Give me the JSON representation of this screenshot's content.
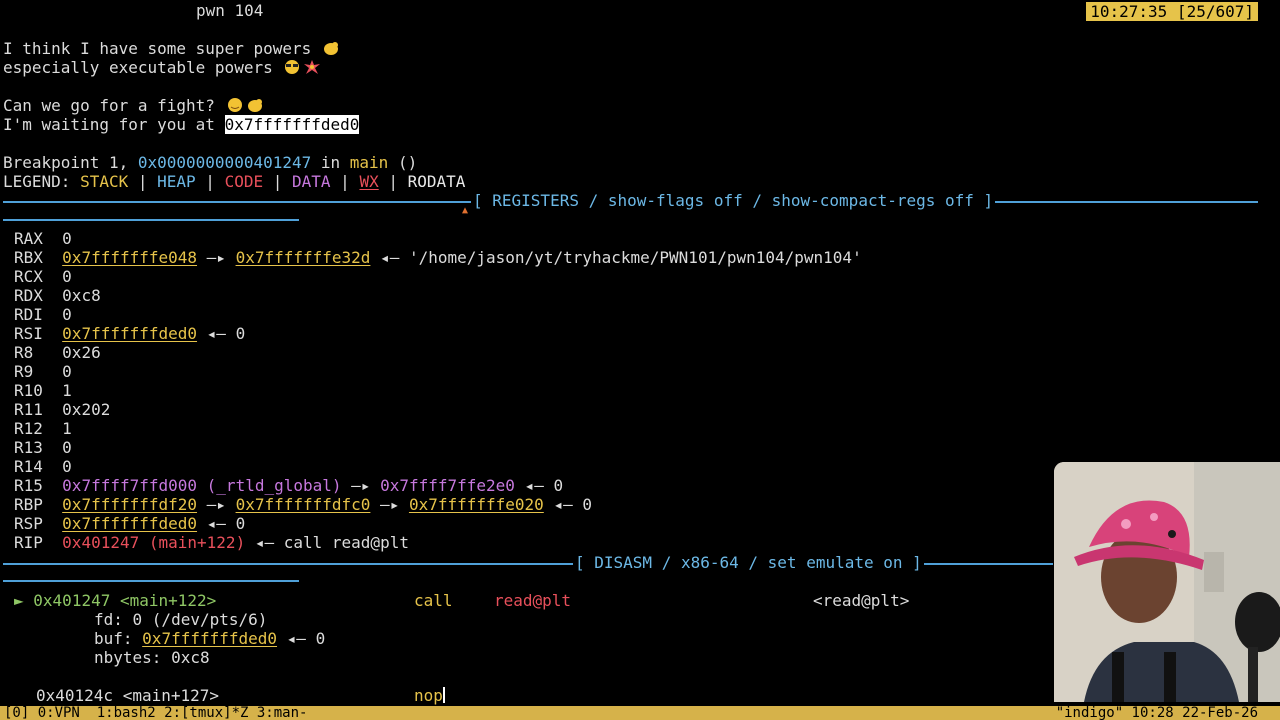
{
  "header": {
    "title": "pwn 104",
    "clock": "10:27:35 [25/607]"
  },
  "program_output": {
    "line1": "I think I have some super powers",
    "line2": "especially executable powers",
    "line3": "Can we go for a fight?",
    "line4_prefix": "I'm waiting for you at ",
    "line4_addr": "0x7fffffffded0"
  },
  "breakpoint": {
    "prefix": "Breakpoint 1, ",
    "addr": "0x0000000000401247",
    "in": " in ",
    "func": "main",
    "args": " ()"
  },
  "legend": {
    "label": "LEGEND: ",
    "stack": "STACK",
    "heap": "HEAP",
    "code": "CODE",
    "data": "DATA",
    "wx": "WX",
    "rodata": "RODATA",
    "sep": " | "
  },
  "registers_title": "[ REGISTERS / show-flags off / show-compact-regs off ]",
  "registers": {
    "rax": {
      "name": "RAX",
      "val": "0"
    },
    "rbx": {
      "name": "RBX",
      "val": "0x7fffffffe048",
      "arrow": " —▸ ",
      "ptr": "0x7fffffffe32d",
      "arrow2": " ◂— ",
      "str": "'/home/jason/yt/tryhackme/PWN101/pwn104/pwn104'"
    },
    "rcx": {
      "name": "RCX",
      "val": "0"
    },
    "rdx": {
      "name": "RDX",
      "val": "0xc8"
    },
    "rdi": {
      "name": "RDI",
      "val": "0"
    },
    "rsi": {
      "name": "RSI",
      "val": "0x7fffffffded0",
      "tail": " ◂— 0"
    },
    "r8": {
      "name": "R8",
      "val": "0x26"
    },
    "r9": {
      "name": "R9",
      "val": "0"
    },
    "r10": {
      "name": "R10",
      "val": "1"
    },
    "r11": {
      "name": "R11",
      "val": "0x202"
    },
    "r12": {
      "name": "R12",
      "val": "1"
    },
    "r13": {
      "name": "R13",
      "val": "0"
    },
    "r14": {
      "name": "R14",
      "val": "0"
    },
    "r15": {
      "name": "R15",
      "val": "0x7ffff7ffd000 (_rtld_global)",
      "arrow": " —▸ ",
      "ptr": "0x7ffff7ffe2e0",
      "tail": " ◂— 0"
    },
    "rbp": {
      "name": "RBP",
      "val": "0x7fffffffdf20",
      "arrow": " —▸ ",
      "ptr": "0x7fffffffdfc0",
      "arrow2": " —▸ ",
      "ptr2": "0x7fffffffe020",
      "tail": " ◂— 0"
    },
    "rsp": {
      "name": "RSP",
      "val": "0x7fffffffded0",
      "tail": " ◂— 0"
    },
    "rip": {
      "name": "RIP",
      "val": "0x401247 (main+122)",
      "tail": " ◂— call read@plt"
    }
  },
  "disasm_title": "[ DISASM / x86-64 / set emulate on ]",
  "disasm": {
    "row1": {
      "marker": "►",
      "addr": "0x401247",
      "sym": "<main+122>",
      "mnem": "call",
      "op": "read@plt",
      "target": "<read@plt>"
    },
    "fd": "fd: 0 (/dev/pts/6)",
    "buf_label": "buf: ",
    "buf_val": "0x7fffffffded0",
    "buf_tail": " ◂— 0",
    "nbytes": "nbytes: 0xc8",
    "row2": {
      "addr": "0x40124c",
      "sym": "<main+127>",
      "mnem": "nop"
    }
  },
  "statusbar": {
    "left": "[0] 0:VPN  1:bash2 2:[tmux]*Z 3:man-",
    "right": "\"indigo\" 10:28 22-Feb-26"
  },
  "colors": {
    "stack": "#e6c34a",
    "heap": "#6cb8e6",
    "code": "#e8505b",
    "data": "#c678dd",
    "status_bar": "#d6b24a"
  }
}
